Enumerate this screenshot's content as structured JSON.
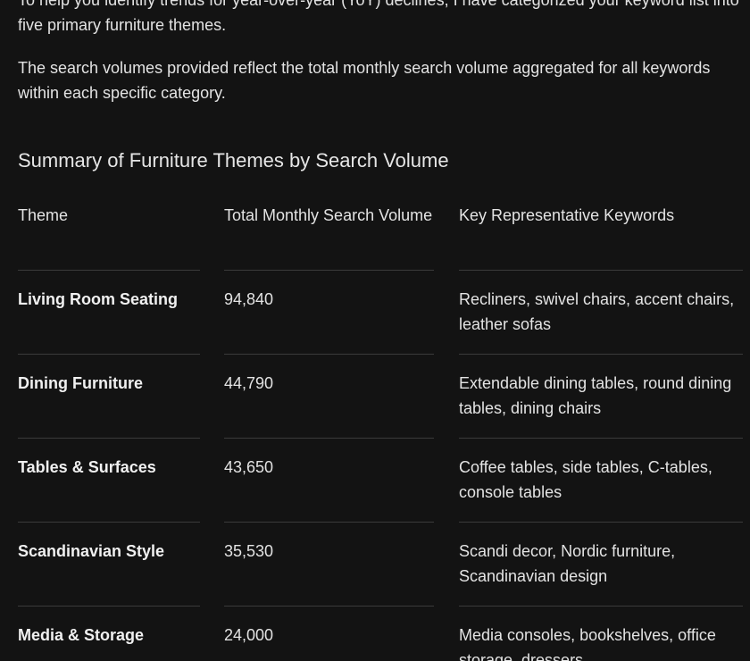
{
  "intro": {
    "paragraph1": "To help you identify trends for year-over-year (YoY) declines, I have categorized your keyword list into five primary furniture themes.",
    "paragraph2": "The search volumes provided reflect the total monthly search volume aggregated for all keywords within each specific category."
  },
  "section": {
    "title": "Summary of Furniture Themes by Search Volume"
  },
  "table": {
    "headers": {
      "theme": "Theme",
      "volume": "Total Monthly Search Volume",
      "keywords": "Key Representative Keywords"
    },
    "rows": [
      {
        "theme": "Living Room Seating",
        "volume": "94,840",
        "keywords": "Recliners, swivel chairs, accent chairs, leather sofas"
      },
      {
        "theme": "Dining Furniture",
        "volume": "44,790",
        "keywords": "Extendable dining tables, round dining tables, dining chairs"
      },
      {
        "theme": "Tables & Surfaces",
        "volume": "43,650",
        "keywords": "Coffee tables, side tables, C-tables, console tables"
      },
      {
        "theme": "Scandinavian Style",
        "volume": "35,530",
        "keywords": "Scandi decor, Nordic furniture, Scandinavian design"
      },
      {
        "theme": "Media & Storage",
        "volume": "24,000",
        "keywords": "Media consoles, bookshelves, office storage, dressers"
      }
    ]
  }
}
